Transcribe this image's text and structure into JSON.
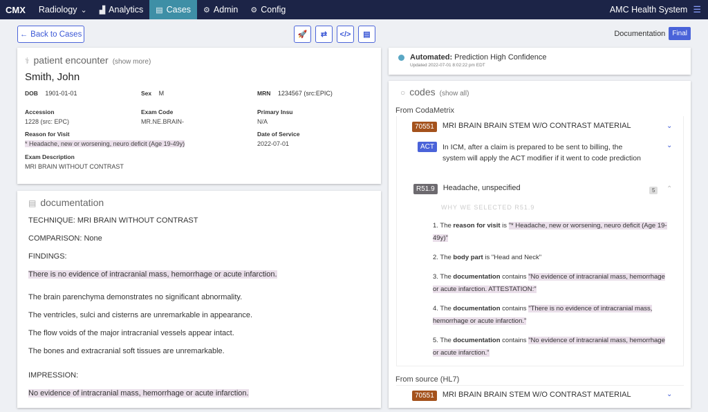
{
  "nav": {
    "brand": "CMX",
    "items": [
      {
        "label": "Radiology",
        "icon": "",
        "dropdown": true
      },
      {
        "label": "Analytics",
        "icon": "bar-chart-icon"
      },
      {
        "label": "Cases",
        "icon": "list-icon",
        "active": true
      },
      {
        "label": "Admin",
        "icon": "gear-icon"
      },
      {
        "label": "Config",
        "icon": "cogs-icon"
      }
    ],
    "org": "AMC Health System"
  },
  "toolbar": {
    "back_label": "Back to Cases",
    "documentation_label": "Documentation",
    "status_badge": "Final"
  },
  "encounter": {
    "title": "patient encounter",
    "show_more": "(show more)",
    "patient_name": "Smith, John",
    "dob_label": "DOB",
    "dob": "1901-01-01",
    "sex_label": "Sex",
    "sex": "M",
    "mrn_label": "MRN",
    "mrn": "1234567 (src:EPIC)",
    "accession_label": "Accession",
    "accession": "1228 (src: EPC)",
    "exam_code_label": "Exam Code",
    "exam_code": "MR.NE.BRAIN-",
    "primary_insu_label": "Primary Insu",
    "primary_insu": "N/A",
    "reason_label": "Reason for Visit",
    "reason": "* Headache, new or worsening, neuro deficit (Age 19-49y)",
    "dos_label": "Date of Service",
    "dos": "2022-07-01",
    "exam_desc_label": "Exam Description",
    "exam_desc": "MRI BRAIN WITHOUT CONTRAST"
  },
  "documentation": {
    "title": "documentation",
    "lines": [
      "TECHNIQUE: MRI BRAIN WITHOUT CONTRAST",
      "COMPARISON: None",
      "FINDINGS:",
      "There is no evidence of intracranial mass, hemorrhage or acute infarction.",
      "The brain parenchyma demonstrates no significant abnormality.",
      "The ventricles, sulci and cisterns are unremarkable in appearance.",
      "The flow voids of the major intracranial vessels appear intact.",
      "The bones and extracranial soft tissues are unremarkable.",
      "IMPRESSION:",
      "No evidence of intracranial mass, hemorrhage or acute infarction."
    ]
  },
  "prediction": {
    "label_bold": "Automated:",
    "label": "Prediction High Confidence",
    "updated": "Updated 2022-07-01 8:02:22 pm EDT"
  },
  "codes": {
    "title": "codes",
    "show_all": "(show all)",
    "from_codametrix": "From CodaMetrix",
    "from_source": "From source (HL7)",
    "code1": {
      "code": "70551",
      "desc": "MRI BRAIN BRAIN STEM W/O CONTRAST MATERIAL"
    },
    "act": {
      "code": "ACT",
      "desc": "In ICM, after a claim is prepared to be sent to billing, the system will apply the ACT modifier if it went to code prediction"
    },
    "r519": {
      "code": "R51.9",
      "desc": "Headache, unspecified",
      "count": "5",
      "why": "WHY WE SELECTED R51.9"
    },
    "reasons": [
      {
        "num": "1.",
        "pre": "The",
        "key": "reason for visit",
        "mid": "is",
        "quote": "\"* Headache, new or worsening, neuro deficit (Age 19-49y)\"",
        "hl": true
      },
      {
        "num": "2.",
        "pre": "The",
        "key": "body part",
        "mid": "is",
        "quote": "\"Head and Neck\"",
        "hl": false
      },
      {
        "num": "3.",
        "pre": "The",
        "key": "documentation",
        "mid": "contains",
        "quote": "\"No evidence of intracranial mass, hemorrhage or acute infarction. ATTESTATION:\"",
        "hl": true
      },
      {
        "num": "4.",
        "pre": "The",
        "key": "documentation",
        "mid": "contains",
        "quote": "\"There is no evidence of intracranial mass, hemorrhage or acute infarction.\"",
        "hl": true
      },
      {
        "num": "5.",
        "pre": "The",
        "key": "documentation",
        "mid": "contains",
        "quote": "\"No evidence of intracranial mass, hemorrhage or acute infarction.\"",
        "hl": true
      }
    ],
    "source_code1": {
      "code": "70551",
      "desc": "MRI BRAIN BRAIN STEM W/O CONTRAST MATERIAL"
    }
  }
}
